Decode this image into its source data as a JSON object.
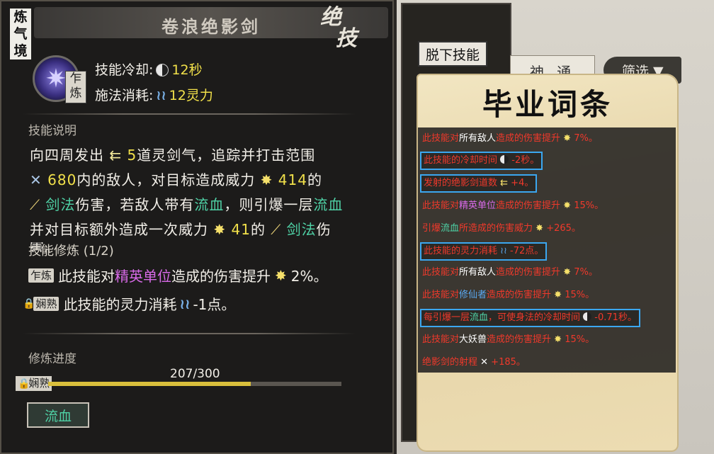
{
  "skill": {
    "realm_tag": "炼气境",
    "title": "卷浪绝影剑",
    "badge": "绝技",
    "stage_badge": "乍炼",
    "cooldown_label": "技能冷却:",
    "cooldown_value": "12秒",
    "cost_label": "施法消耗:",
    "cost_value": "12灵力"
  },
  "description": {
    "label": "技能说明",
    "line1_a": "向四周发出",
    "line1_num": "5",
    "line1_b": "道灵剑气，追踪并打击范围",
    "line2_num": "680",
    "line2_a": "内的敌人，对目标造成威力",
    "line2_num2": "414",
    "line2_b": "的",
    "line3_a": "剑法",
    "line3_b": "伤害，若敌人带有",
    "line3_c": "流血",
    "line3_d": "，则引爆一层",
    "line3_e": "流血",
    "line4_a": "并对目标额外造成一次威力",
    "line4_num": "41",
    "line4_b": "的",
    "line4_c": "剑法",
    "line4_d": "伤",
    "line5": "害。"
  },
  "training": {
    "label": "技能修炼 (1/2)",
    "item1_tag": "乍炼",
    "item1_a": "此技能对",
    "item1_b": "精英单位",
    "item1_c": "造成的伤害提升",
    "item1_d": "2%。",
    "item2_tag": "娴熟",
    "item2_a": "此技能的灵力消耗",
    "item2_b": "-1点。"
  },
  "progress": {
    "label": "修炼进度",
    "tag": "娴熟",
    "text": "207/300",
    "fraction": 0.69
  },
  "bleed_button": "流血",
  "unequip_button": "脱下技能",
  "bg": {
    "tabs": "神 通",
    "filter": "筛选 ▼"
  },
  "parchment": {
    "title": "毕业词条",
    "affixes": [
      "此技能对所有敌人造成的伤害提升 ✸ 7%。",
      "此技能的冷却时间 ◐ -2秒。",
      "发射的绝影剑道数 ⇇ +4。",
      "此技能对精英单位造成的伤害提升 ✸ 15%。",
      "引爆流血所造成的伤害威力 ✸ +265。",
      "此技能的灵力消耗 ≀≀ -72点。",
      "此技能对所有敌人造成的伤害提升 ✸ 7%。",
      "此技能对修仙者造成的伤害提升 ✸ 15%。",
      "每引爆一层流血，可使身法的冷却时间 ◐ -0.71秒。",
      "此技能对大妖兽造成的伤害提升 ✸ 15%。",
      "绝影剑的射程 ✕ +185。"
    ]
  }
}
